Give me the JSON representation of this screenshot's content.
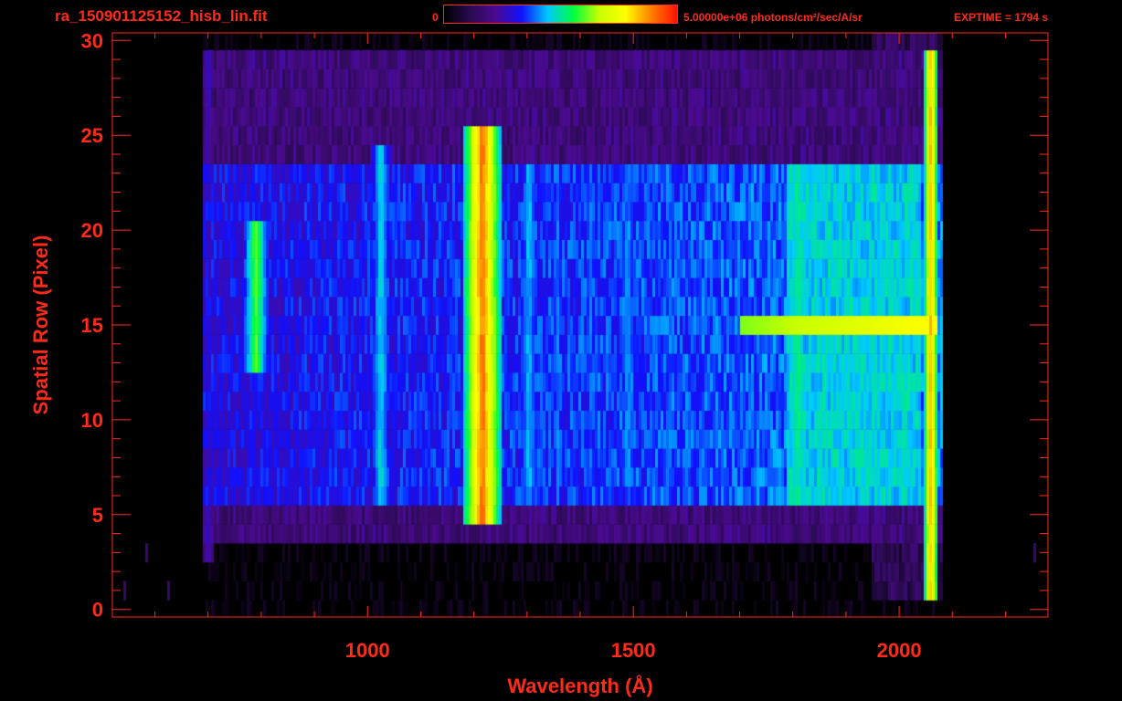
{
  "header": {
    "file_title": "ra_150901125152_hisb_lin.fit",
    "colorbar_min_label": "0",
    "colorbar_max_label": "5.00000e+06 photons/cm²/sec/A/sr",
    "exptime_label": "EXPTIME = 1794 s"
  },
  "colors": {
    "background": "#000000",
    "axes": "#ff2a1a",
    "colormap": [
      "#000000",
      "#2a0a50",
      "#4b0a90",
      "#1010ff",
      "#00c8ff",
      "#00ff40",
      "#c8ff00",
      "#ffff00",
      "#ff8000",
      "#ff1000"
    ]
  },
  "chart_data": {
    "type": "heatmap",
    "title": "ra_150901125152_hisb_lin.fit",
    "xlabel": "Wavelength (Å)",
    "ylabel": "Spatial Row (Pixel)",
    "xlim": [
      520,
      2280
    ],
    "ylim": [
      -0.4,
      30.4
    ],
    "x_ticks": [
      1000,
      1500,
      2000
    ],
    "y_ticks": [
      0,
      5,
      10,
      15,
      20,
      25,
      30
    ],
    "x_tick_labels": [
      "1000",
      "1500",
      "2000"
    ],
    "y_tick_labels": [
      "0",
      "5",
      "10",
      "15",
      "20",
      "25",
      "30"
    ],
    "colorbar": {
      "min": 0,
      "max": 5000000,
      "units": "photons/cm²/sec/A/sr"
    },
    "slit_rows": {
      "bright_from": 6,
      "bright_to": 23,
      "faint_from": 4,
      "faint_to": 29
    },
    "wavelength_extent": [
      690,
      2080
    ],
    "emission_features": [
      {
        "wavelength": 700,
        "rows": [
          3,
          29
        ],
        "level": 0.28,
        "width": 12
      },
      {
        "wavelength": 790,
        "rows": [
          13,
          20
        ],
        "level": 0.6,
        "width": 25
      },
      {
        "wavelength": 1025,
        "rows": [
          6,
          24
        ],
        "level": 0.48,
        "width": 22
      },
      {
        "wavelength": 1216,
        "rows": [
          5,
          25
        ],
        "level": 0.92,
        "width": 34
      },
      {
        "wavelength": 1304,
        "rows": [
          6,
          23
        ],
        "level": 0.45,
        "width": 22
      },
      {
        "wavelength": 1357,
        "rows": [
          7,
          23
        ],
        "level": 0.4,
        "width": 16
      },
      {
        "wavelength": 1420,
        "rows": [
          7,
          23
        ],
        "level": 0.38,
        "width": 22
      },
      {
        "wavelength": 1490,
        "rows": [
          7,
          23
        ],
        "level": 0.42,
        "width": 24
      },
      {
        "wavelength": 1570,
        "rows": [
          7,
          23
        ],
        "level": 0.38,
        "width": 24
      },
      {
        "wavelength": 1650,
        "rows": [
          7,
          23
        ],
        "level": 0.36,
        "width": 20
      },
      {
        "wavelength": 1810,
        "rows": [
          6,
          23
        ],
        "level": 0.52,
        "width": 38
      },
      {
        "wavelength": 2060,
        "rows": [
          1,
          29
        ],
        "level": 0.85,
        "width": 14
      }
    ],
    "horizontal_band": {
      "row": 15,
      "from": 1700,
      "to": 2070,
      "level": 0.78
    }
  }
}
